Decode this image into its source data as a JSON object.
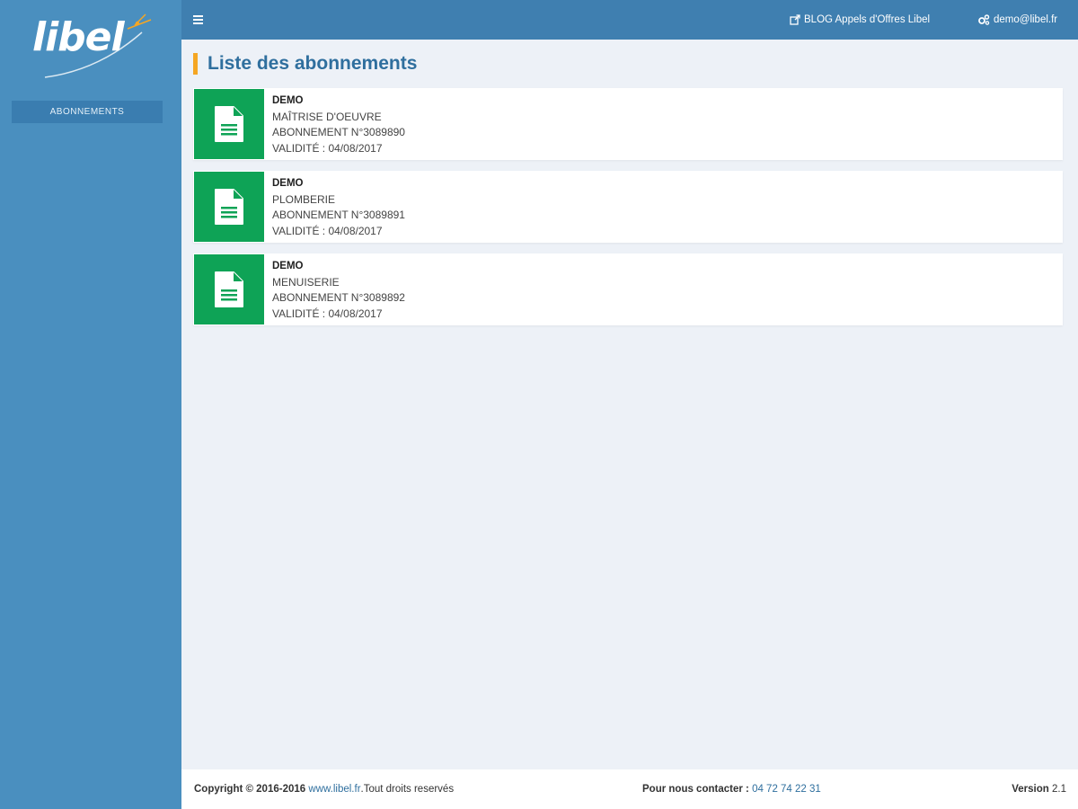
{
  "logo": {
    "text": "libel"
  },
  "sidebar": {
    "items": [
      {
        "label": "ABONNEMENTS"
      }
    ]
  },
  "topbar": {
    "blog_label": "BLOG Appels d'Offres Libel",
    "user_label": "demo@libel.fr"
  },
  "page": {
    "title": "Liste des abonnements"
  },
  "subscriptions": [
    {
      "name": "DEMO",
      "category": "MAÎTRISE D'OEUVRE",
      "number": "ABONNEMENT N°3089890",
      "validity": "VALIDITÉ : 04/08/2017"
    },
    {
      "name": "DEMO",
      "category": "PLOMBERIE",
      "number": "ABONNEMENT N°3089891",
      "validity": "VALIDITÉ : 04/08/2017"
    },
    {
      "name": "DEMO",
      "category": "MENUISERIE",
      "number": "ABONNEMENT N°3089892",
      "validity": "VALIDITÉ : 04/08/2017"
    }
  ],
  "footer": {
    "copyright_prefix": "Copyright © 2016-2016",
    "site_link": "www.libel.fr",
    "copyright_suffix": ".Tout droits reservés",
    "contact_label": "Pour nous contacter :",
    "phone": "04 72 74 22 31",
    "version_label": "Version",
    "version_value": "2.1"
  },
  "colors": {
    "sidebar": "#4a8fbf",
    "topbar": "#3f7fb0",
    "accent_green": "#0ea356",
    "title_bar": "#f5a623",
    "title_text": "#2f6f9e"
  },
  "icons": {
    "menu": "hamburger-icon",
    "blog": "external-link-icon",
    "user": "gears-icon",
    "subscription": "document-icon"
  }
}
